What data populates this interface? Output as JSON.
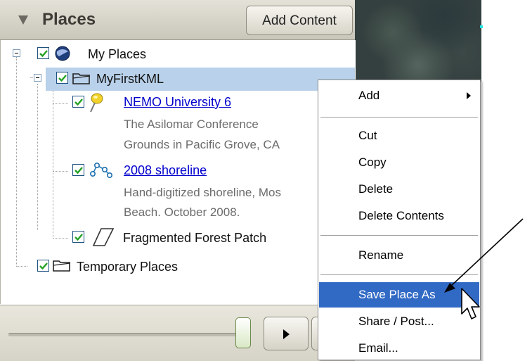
{
  "panel": {
    "title": "Places",
    "add_content_label": "Add Content"
  },
  "tree": {
    "my_places": "My Places",
    "myfirstkml": "MyFirstKML",
    "nemo": {
      "title": "NEMO University 6",
      "desc_line1": "The Asilomar Conference",
      "desc_line2": "Grounds in Pacific Grove, CA"
    },
    "shoreline": {
      "title": "2008 shoreline",
      "desc_line1": "Hand-digitized shoreline, Mos",
      "desc_line2": "Beach. October 2008."
    },
    "forest": "Fragmented Forest Patch",
    "temporary": "Temporary Places"
  },
  "context_menu": {
    "add": "Add",
    "cut": "Cut",
    "copy": "Copy",
    "delete": "Delete",
    "delete_contents": "Delete Contents",
    "rename": "Rename",
    "save_place_as": "Save Place As",
    "share_post": "Share / Post...",
    "email": "Email..."
  },
  "colors": {
    "selection": "#b9d1ea",
    "menu_highlight": "#316ac5",
    "link": "#0000cc",
    "checkbox_check": "#21a121"
  },
  "icons": [
    "collapse-triangle-icon",
    "checkbox-icon",
    "globe-icon",
    "folder-icon",
    "pushpin-icon",
    "path-icon",
    "polygon-icon",
    "play-icon",
    "submenu-arrow-icon",
    "mouse-pointer-icon",
    "annotation-arrow-icon"
  ]
}
